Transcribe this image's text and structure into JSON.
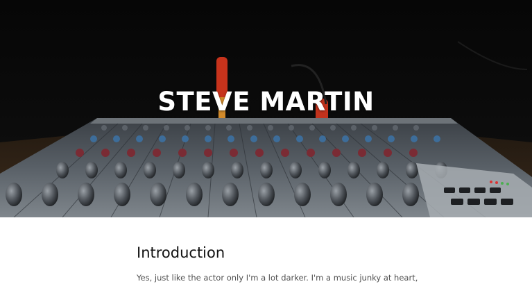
{
  "hero": {
    "title": "STEVE MARTIN",
    "background_image": "audio-mixing-console"
  },
  "introduction": {
    "heading": "Introduction",
    "text": "Yes, just like the actor only I'm a lot darker. I'm a music junky at heart,"
  },
  "colors": {
    "hero_background": "#070707",
    "hero_title": "#ffffff",
    "heading": "#111111",
    "body_text": "#4f4f4f",
    "page_background": "#ffffff"
  }
}
